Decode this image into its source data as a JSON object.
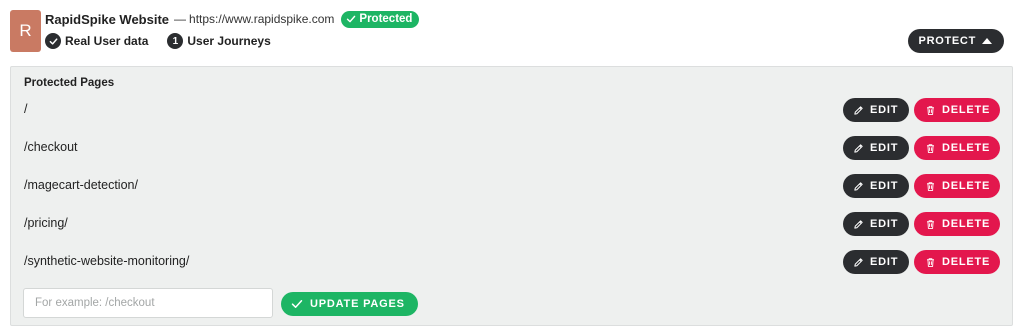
{
  "site": {
    "avatar_letter": "R",
    "name": "RapidSpike Website",
    "separator": "—",
    "url": "https://www.rapidspike.com",
    "status_badge": "Protected",
    "meta": {
      "real_user_label": "Real User data",
      "journeys_count": "1",
      "journeys_label": "User Journeys"
    }
  },
  "protect_button": {
    "label": "PROTECT",
    "icon": "caret-up-icon"
  },
  "panel": {
    "title": "Protected Pages",
    "pages": [
      {
        "path": "/"
      },
      {
        "path": "/checkout"
      },
      {
        "path": "/magecart-detection/"
      },
      {
        "path": "/pricing/"
      },
      {
        "path": "/synthetic-website-monitoring/"
      }
    ],
    "edit_label": "EDIT",
    "delete_label": "DELETE",
    "input_value": "",
    "input_placeholder": "For example: /checkout",
    "update_label": "UPDATE PAGES"
  },
  "colors": {
    "dark": "#2b2d30",
    "green": "#1db564",
    "red": "#e3174d",
    "avatar": "#c97a63",
    "panel_bg": "#eef0ef"
  }
}
